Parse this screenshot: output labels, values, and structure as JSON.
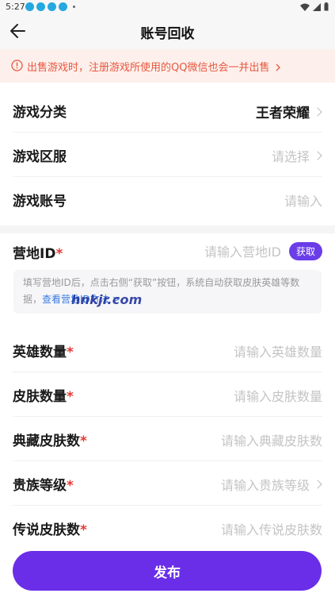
{
  "status_bar": {
    "time": "5:27"
  },
  "nav": {
    "title": "账号回收"
  },
  "notice": {
    "text": "出售游戏时，注册游戏所使用的QQ微信也会一并出售"
  },
  "basic": {
    "category": {
      "label": "游戏分类",
      "value": "王者荣耀"
    },
    "server": {
      "label": "游戏区服",
      "placeholder": "请选择"
    },
    "account": {
      "label": "游戏账号",
      "placeholder": "请输入"
    }
  },
  "camp": {
    "label": "营地ID",
    "required_mark": "*",
    "placeholder": "请输入营地ID",
    "fetch_label": "获取",
    "hint": "填写营地ID后，点击右侧“获取”按钮，系统自动获取皮肤英雄等数据，",
    "hint_link": "查看营地ID方法 >",
    "watermark": "hnkjr.com"
  },
  "details": {
    "heroes": {
      "label": "英雄数量",
      "placeholder": "请输入英雄数量"
    },
    "skins": {
      "label": "皮肤数量",
      "placeholder": "请输入皮肤数量"
    },
    "collection_skins": {
      "label": "典藏皮肤数",
      "placeholder": "请输入典藏皮肤数"
    },
    "noble_level": {
      "label": "贵族等级",
      "placeholder": "请输入贵族等级"
    },
    "legend_skins": {
      "label": "传说皮肤数",
      "placeholder": "请输入传说皮肤数"
    }
  },
  "publish": {
    "label": "发布"
  },
  "colors": {
    "accent": "#6a2ee8",
    "notice": "#e8573f",
    "required": "#e53935"
  },
  "icons": [
    "back-arrow-icon",
    "info-circle-icon",
    "chevron-right-icon",
    "wifi-icon",
    "signal-icon",
    "battery-icon"
  ]
}
